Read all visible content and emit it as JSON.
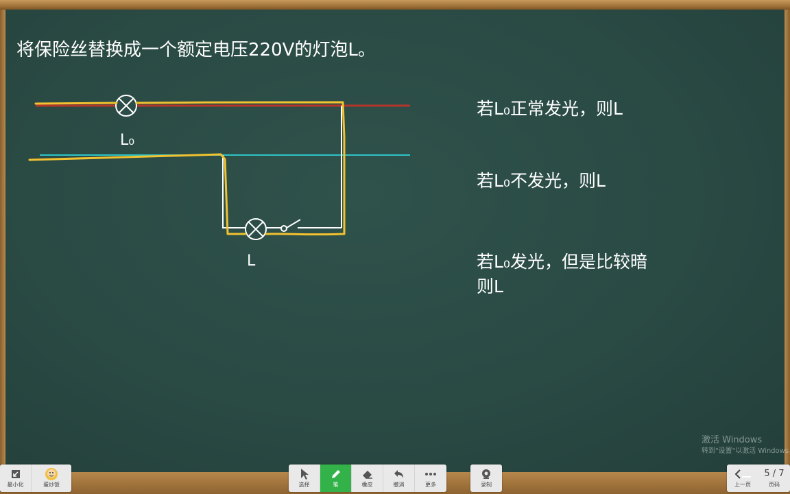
{
  "board": {
    "title": "将保险丝替换成一个额定电压220V的灯泡L。",
    "conditions": [
      "若L₀正常发光，则L",
      "若L₀不发光，则L",
      "若L₀发光，但是比较暗",
      "则L"
    ],
    "lamp_labels": {
      "test_lamp": "L₀",
      "load_lamp": "L"
    }
  },
  "watermark": {
    "line1": "激活 Windows",
    "line2": "转到\"设置\"以激活 Windows。"
  },
  "toolbar": {
    "left": [
      {
        "label": "最小化",
        "icon": "minimize-icon"
      },
      {
        "label": "蛋炒饭",
        "icon": "avatar-icon"
      }
    ],
    "center": [
      {
        "label": "选择",
        "icon": "cursor-icon"
      },
      {
        "label": "笔",
        "icon": "pen-icon"
      },
      {
        "label": "橡皮",
        "icon": "eraser-icon"
      },
      {
        "label": "撤消",
        "icon": "undo-icon"
      },
      {
        "label": "更多",
        "icon": "more-icon"
      }
    ],
    "record": {
      "label": "录制",
      "icon": "record-icon"
    },
    "right": {
      "prev_label": "上一页",
      "page_label": "页码",
      "page_indicator": "5 / 7"
    }
  },
  "colors": {
    "board": "#2a4a44",
    "live_wire": "#b5352a",
    "neutral_wire": "#2ec4c8",
    "highlight_path": "#f2c230",
    "active_tool": "#33b24a"
  }
}
